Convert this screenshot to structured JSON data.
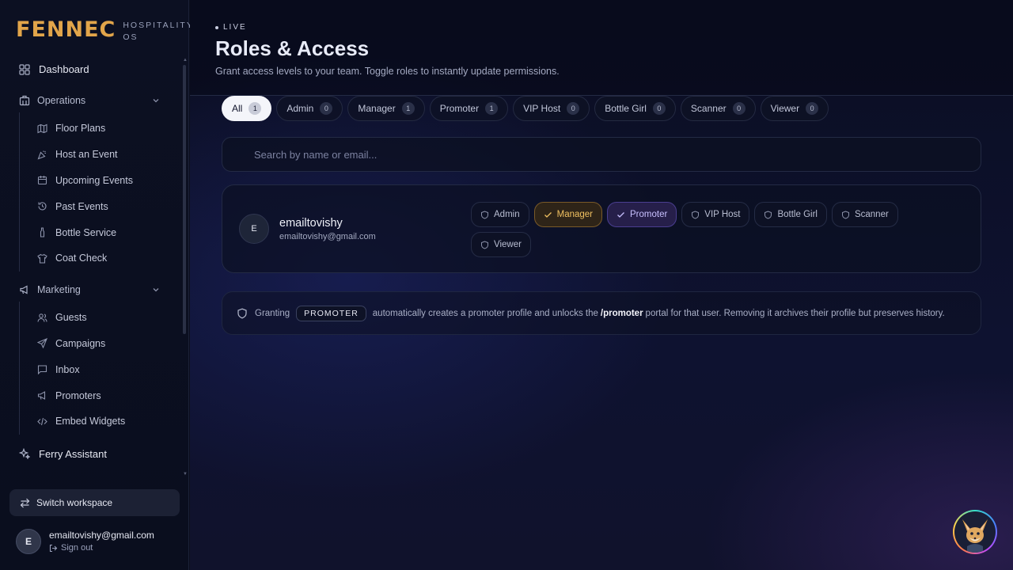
{
  "brand": {
    "logo": "FENNEC",
    "subtitle": "HOSPITALITY OS"
  },
  "nav": {
    "dashboard": "Dashboard",
    "operations": {
      "label": "Operations",
      "items": [
        "Floor Plans",
        "Host an Event",
        "Upcoming Events",
        "Past Events",
        "Bottle Service",
        "Coat Check"
      ]
    },
    "marketing": {
      "label": "Marketing",
      "items": [
        "Guests",
        "Campaigns",
        "Inbox",
        "Promoters",
        "Embed Widgets"
      ]
    },
    "assistant": "Ferry Assistant",
    "switch_workspace": "Switch workspace"
  },
  "user": {
    "initial": "E",
    "email": "emailtovishy@gmail.com",
    "sign_out": "Sign out"
  },
  "header": {
    "status": "LIVE",
    "title": "Roles & Access",
    "subtitle": "Grant access levels to your team. Toggle roles to instantly update permissions."
  },
  "tabs": [
    {
      "label": "All",
      "count": "1"
    },
    {
      "label": "Admin",
      "count": "0"
    },
    {
      "label": "Manager",
      "count": "1"
    },
    {
      "label": "Promoter",
      "count": "1"
    },
    {
      "label": "VIP Host",
      "count": "0"
    },
    {
      "label": "Bottle Girl",
      "count": "0"
    },
    {
      "label": "Scanner",
      "count": "0"
    },
    {
      "label": "Viewer",
      "count": "0"
    }
  ],
  "search": {
    "placeholder": "Search by name or email..."
  },
  "member": {
    "initial": "E",
    "name": "emailtovishy",
    "email": "emailtovishy@gmail.com",
    "roles": [
      {
        "label": "Admin",
        "active": false
      },
      {
        "label": "Manager",
        "active": true
      },
      {
        "label": "Promoter",
        "active": true
      },
      {
        "label": "VIP Host",
        "active": false
      },
      {
        "label": "Bottle Girl",
        "active": false
      },
      {
        "label": "Scanner",
        "active": false
      },
      {
        "label": "Viewer",
        "active": false
      }
    ]
  },
  "info": {
    "prefix": "Granting",
    "role_pill": "PROMOTER",
    "middle": "automatically creates a promoter profile and unlocks the",
    "path": "/promoter",
    "suffix": "portal for that user. Removing it archives their profile but preserves history."
  },
  "colors": {
    "accent": "#e2a54a",
    "manager": "#f0c060",
    "promoter": "#c8c0ff"
  }
}
